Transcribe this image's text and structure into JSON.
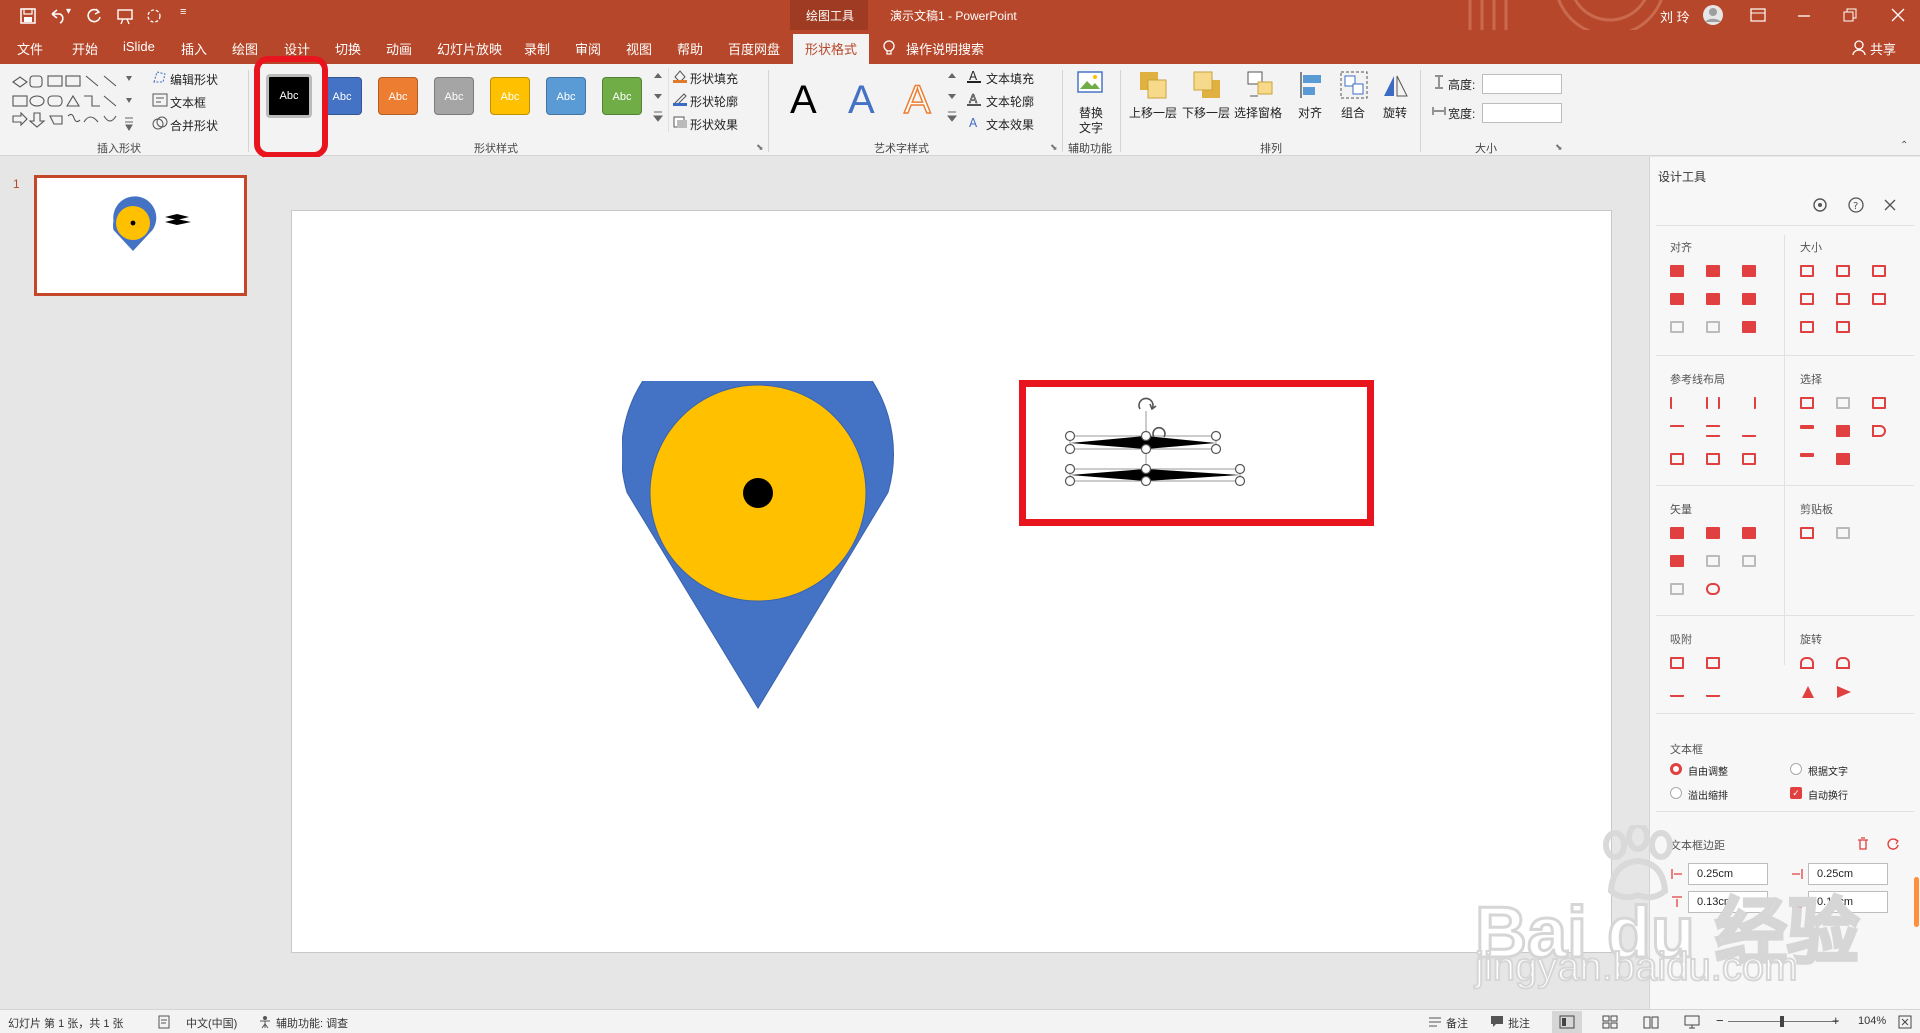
{
  "title_bar": {
    "drawing_tools": "绘图工具",
    "doc_title": "演示文稿1  -  PowerPoint",
    "user": "刘 玲"
  },
  "tabs": [
    "文件",
    "开始",
    "iSlide",
    "插入",
    "绘图",
    "设计",
    "切换",
    "动画",
    "幻灯片放映",
    "录制",
    "审阅",
    "视图",
    "帮助",
    "百度网盘",
    "形状格式"
  ],
  "active_tab": "形状格式",
  "tell_me": "操作说明搜索",
  "share": "共享",
  "ribbon": {
    "insert_shapes": {
      "label": "插入形状",
      "edit_shape": "编辑形状",
      "text_box": "文本框",
      "merge_shapes": "合并形状"
    },
    "shape_styles": {
      "label": "形状样式",
      "swatch_text": "Abc",
      "swatches": [
        "#000000",
        "#4472c4",
        "#ed7d31",
        "#a5a5a5",
        "#ffc000",
        "#5b9bd5",
        "#70ad47"
      ],
      "fill": "形状填充",
      "outline": "形状轮廓",
      "effects": "形状效果"
    },
    "wordart": {
      "label": "艺术字样式",
      "letter": "A",
      "text_fill": "文本填充",
      "text_outline": "文本轮廓",
      "text_effects": "文本效果"
    },
    "accessibility": {
      "label": "辅助功能",
      "alt_text_1": "替换",
      "alt_text_2": "文字"
    },
    "arrange": {
      "label": "排列",
      "bring_forward": "上移一层",
      "send_backward": "下移一层",
      "selection_pane": "选择窗格",
      "align": "对齐",
      "group": "组合",
      "rotate": "旋转"
    },
    "size": {
      "label": "大小",
      "height": "高度:",
      "width": "宽度:"
    }
  },
  "thumbnail": {
    "number": "1"
  },
  "colors": {
    "accent": "#b7472a",
    "pin_blue": "#4472c4",
    "pin_yellow": "#ffc000",
    "highlight": "#e8151f"
  },
  "side_panel": {
    "title": "设计工具",
    "sections": {
      "align": "对齐",
      "size": "大小",
      "guides": "参考线布局",
      "select": "选择",
      "vector": "矢量",
      "clipboard": "剪贴板",
      "snap": "吸附",
      "rotate": "旋转",
      "textbox": "文本框",
      "margins": "文本框边距"
    },
    "textbox_options": {
      "auto_adjust": "自由调整",
      "overflow": "溢出缩排",
      "by_text": "根据文字",
      "auto_wrap": "自动换行"
    },
    "margins": {
      "left": "0.25cm",
      "right": "0.25cm",
      "top": "0.13cm",
      "bottom": "0.13cm"
    }
  },
  "status": {
    "slide_info": "幻灯片 第 1 张，共 1 张",
    "language": "中文(中国)",
    "accessibility": "辅助功能: 调查",
    "notes": "备注",
    "comments": "批注",
    "zoom": "104%"
  },
  "watermark": {
    "brand": "Bai du 经验",
    "url": "jingyan.baidu.com"
  }
}
